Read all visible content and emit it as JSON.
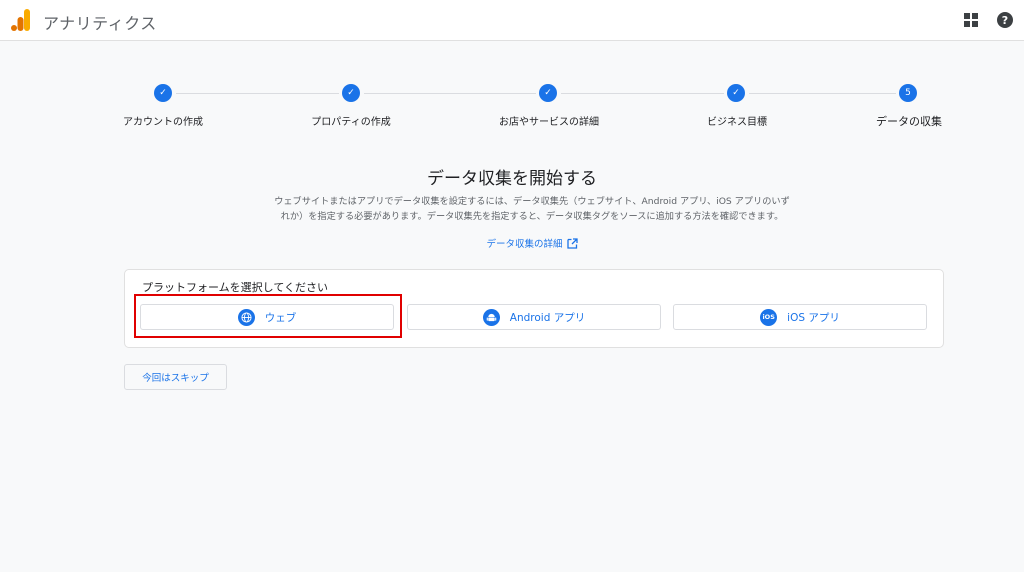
{
  "header": {
    "title": "アナリティクス",
    "logo_icon": "analytics-logo-icon",
    "apps_icon": "apps-grid-icon",
    "help_icon": "help-icon"
  },
  "colors": {
    "accent": "#1a73e8",
    "highlight": "#e00000",
    "logo_orange": "#f9ab00",
    "logo_dark": "#e37400"
  },
  "stepper": {
    "steps": [
      {
        "label": "アカウントの作成",
        "state": "completed",
        "marker": "✓"
      },
      {
        "label": "プロパティの作成",
        "state": "completed",
        "marker": "✓"
      },
      {
        "label": "お店やサービスの詳細",
        "state": "completed",
        "marker": "✓"
      },
      {
        "label": "ビジネス目標",
        "state": "completed",
        "marker": "✓"
      },
      {
        "label": "データの収集",
        "state": "current",
        "marker": "5"
      }
    ]
  },
  "main": {
    "heading": "データ収集を開始する",
    "description_line1": "ウェブサイトまたはアプリでデータ収集を設定するには、データ収集先（ウェブサイト、Android アプリ、iOS アプリのいず",
    "description_line2": "れか）を指定する必要があります。データ収集先を指定すると、データ収集タグをソースに追加する方法を確認できます。",
    "detail_link": "データ収集の詳細"
  },
  "platform_card": {
    "title": "プラットフォームを選択してください",
    "options": [
      {
        "label": "ウェブ",
        "icon": "globe-icon",
        "highlighted": true
      },
      {
        "label": "Android アプリ",
        "icon": "android-icon",
        "highlighted": false
      },
      {
        "label": "iOS アプリ",
        "icon": "ios-icon",
        "icon_text": "iOS",
        "highlighted": false
      }
    ]
  },
  "skip_button": "今回はスキップ"
}
